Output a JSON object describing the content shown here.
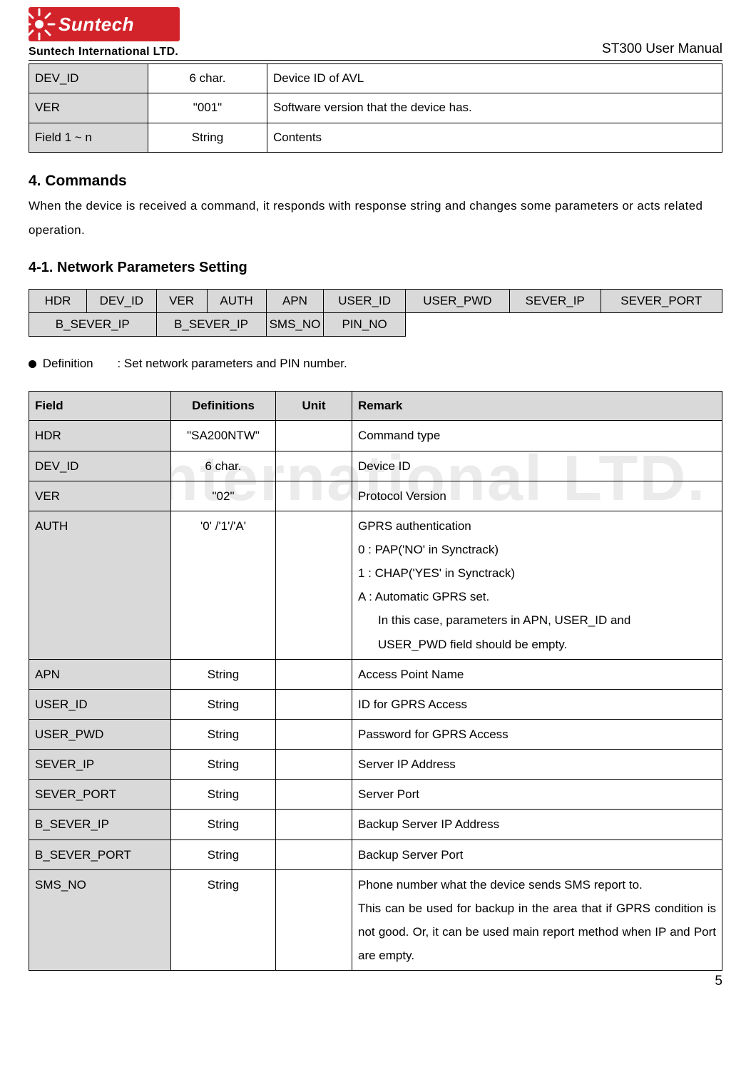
{
  "header": {
    "brand_main": "Suntech",
    "brand_sub": "Suntech International LTD.",
    "doc_title": "ST300 User Manual"
  },
  "top_table": [
    {
      "name": "DEV_ID",
      "def": "6 char.",
      "remark": "Device ID of AVL"
    },
    {
      "name": "VER",
      "def": "\"001\"",
      "remark": "Software version that the device has."
    },
    {
      "name": "Field 1 ~ n",
      "def": "String",
      "remark": "Contents"
    }
  ],
  "sec4": {
    "title": "4. Commands",
    "para": "When the device is received a command, it responds with response string and changes some parameters or acts related operation."
  },
  "sec41": {
    "title": "4-1. Network Parameters Setting"
  },
  "banner": {
    "row1": [
      "HDR",
      "DEV_ID",
      "VER",
      "AUTH",
      "APN",
      "USER_ID",
      "USER_PWD",
      "SEVER_IP",
      "SEVER_PORT"
    ],
    "row2": [
      "B_SEVER_IP",
      "B_SEVER_IP",
      "SMS_NO",
      "PIN_NO"
    ]
  },
  "definition": {
    "label": "Definition",
    "text": ": Set network parameters and PIN number."
  },
  "details": {
    "headers": [
      "Field",
      "Definitions",
      "Unit",
      "Remark"
    ],
    "rows": [
      {
        "field": "HDR",
        "def": "\"SA200NTW\"",
        "unit": "",
        "remark_lines": [
          "Command type"
        ]
      },
      {
        "field": "DEV_ID",
        "def": "6 char.",
        "unit": "",
        "remark_lines": [
          "Device ID"
        ]
      },
      {
        "field": "VER",
        "def": "\"02\"",
        "unit": "",
        "remark_lines": [
          "Protocol Version"
        ]
      },
      {
        "field": "AUTH",
        "def": "'0' /'1'/'A'",
        "unit": "",
        "remark_lines": [
          "GPRS authentication",
          "0 : PAP('NO' in Synctrack)",
          "1 : CHAP('YES' in Synctrack)",
          "A : Automatic GPRS set.",
          "In this case, parameters in APN, USER_ID and",
          "USER_PWD field should be empty."
        ],
        "indent_from": 4
      },
      {
        "field": "APN",
        "def": "String",
        "unit": "",
        "remark_lines": [
          "Access Point Name"
        ]
      },
      {
        "field": "USER_ID",
        "def": "String",
        "unit": "",
        "remark_lines": [
          "ID for GPRS Access"
        ]
      },
      {
        "field": "USER_PWD",
        "def": "String",
        "unit": "",
        "remark_lines": [
          "Password for GPRS Access"
        ]
      },
      {
        "field": "SEVER_IP",
        "def": "String",
        "unit": "",
        "remark_lines": [
          "Server IP Address"
        ]
      },
      {
        "field": "SEVER_PORT",
        "def": "String",
        "unit": "",
        "remark_lines": [
          "Server Port"
        ]
      },
      {
        "field": "B_SEVER_IP",
        "def": "String",
        "unit": "",
        "remark_lines": [
          "Backup Server IP Address"
        ]
      },
      {
        "field": "B_SEVER_PORT",
        "def": "String",
        "unit": "",
        "remark_lines": [
          "Backup Server Port"
        ]
      },
      {
        "field": "SMS_NO",
        "def": "String",
        "unit": "",
        "remark_lines": [
          "Phone number what the device sends SMS report to.",
          "This can be used for backup in the area that if GPRS condition is not good. Or, it can be used main report method when IP and Port are empty."
        ],
        "justify_from": 1
      }
    ]
  },
  "watermark": "ch International LTD.",
  "pagenum": "5"
}
